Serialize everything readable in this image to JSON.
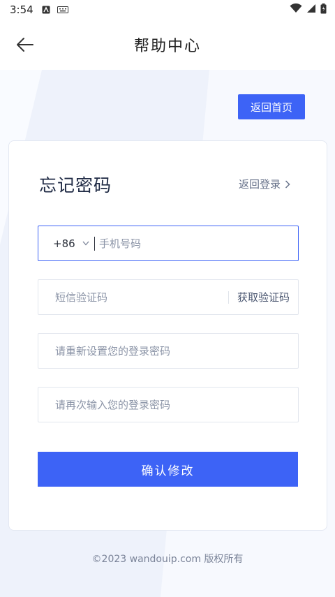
{
  "status_bar": {
    "time": "3:54"
  },
  "header": {
    "title": "帮助中心"
  },
  "home_button": {
    "label": "返回首页"
  },
  "form": {
    "title": "忘记密码",
    "back_login": "返回登录",
    "country_code": "+86",
    "phone_placeholder": "手机号码",
    "sms_placeholder": "短信验证码",
    "get_code_label": "获取验证码",
    "new_password_placeholder": "请重新设置您的登录密码",
    "confirm_password_placeholder": "请再次输入您的登录密码",
    "submit_label": "确认修改"
  },
  "footer": {
    "copyright": "©2023 wandouip.com 版权所有"
  },
  "colors": {
    "accent": "#3d63f6",
    "background": "#f4f7fd"
  }
}
